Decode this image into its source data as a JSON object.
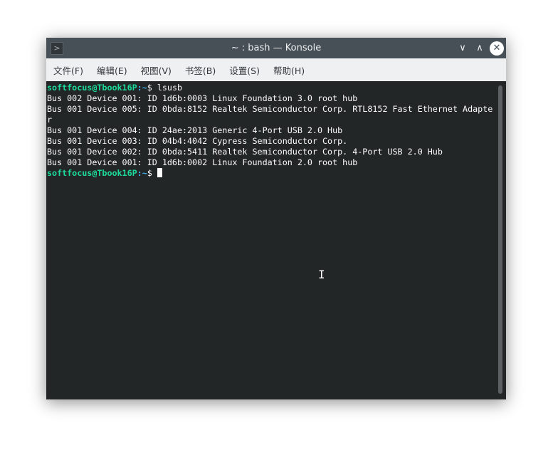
{
  "window": {
    "title": "~ : bash — Konsole",
    "minimize_icon": "chevron-down",
    "maximize_icon": "chevron-up",
    "close_icon": "close"
  },
  "menu": [
    "文件(F)",
    "编辑(E)",
    "视图(V)",
    "书签(B)",
    "设置(S)",
    "帮助(H)"
  ],
  "terminal": {
    "user_host": "softfocus@Tbook16P",
    "path": ":~",
    "prompt_symbol": "$ ",
    "command": "lsusb",
    "output": [
      "Bus 002 Device 001: ID 1d6b:0003 Linux Foundation 3.0 root hub",
      "Bus 001 Device 005: ID 0bda:8152 Realtek Semiconductor Corp. RTL8152 Fast Ethernet Adapte",
      "r",
      "Bus 001 Device 004: ID 24ae:2013 Generic 4-Port USB 2.0 Hub",
      "Bus 001 Device 003: ID 04b4:4042 Cypress Semiconductor Corp.",
      "Bus 001 Device 002: ID 0bda:5411 Realtek Semiconductor Corp. 4-Port USB 2.0 Hub",
      "Bus 001 Device 001: ID 1d6b:0002 Linux Foundation 2.0 root hub"
    ]
  }
}
